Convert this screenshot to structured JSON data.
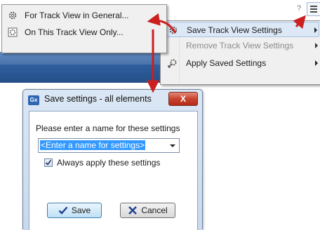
{
  "toolbar": {
    "help_glyph": "?",
    "menu_icon": "hamburger-icon"
  },
  "left_menu": {
    "items": [
      {
        "label": "For Track View in General...",
        "icon": "gear-icon"
      },
      {
        "label": "On This Track View Only...",
        "icon": "track-settings-icon"
      }
    ]
  },
  "right_menu": {
    "items": [
      {
        "label": "Save Track View Settings",
        "icon": "gear-icon",
        "highlighted": true,
        "enabled": true,
        "submenu": true
      },
      {
        "label": "Remove Track View Settings",
        "icon": "",
        "highlighted": false,
        "enabled": false,
        "submenu": true
      },
      {
        "label": "Apply Saved Settings",
        "icon": "apply-settings-icon",
        "highlighted": false,
        "enabled": true,
        "submenu": true
      }
    ]
  },
  "dialog": {
    "app_icon_text": "Gx",
    "title": "Save settings - all elements",
    "close_glyph": "X",
    "prompt": "Please enter a name for these settings",
    "name_field": {
      "value": "<Enter a name for settings>"
    },
    "always_apply": {
      "label": "Always apply these settings",
      "checked": true
    },
    "save_label": "Save",
    "cancel_label": "Cancel"
  },
  "colors": {
    "annotation_arrow": "#cc1f1f",
    "selection": "#3399ff",
    "menu_highlight": "#dde8f6",
    "dialog_frame": "#c8d9ee",
    "close_button": "#c8432e"
  }
}
